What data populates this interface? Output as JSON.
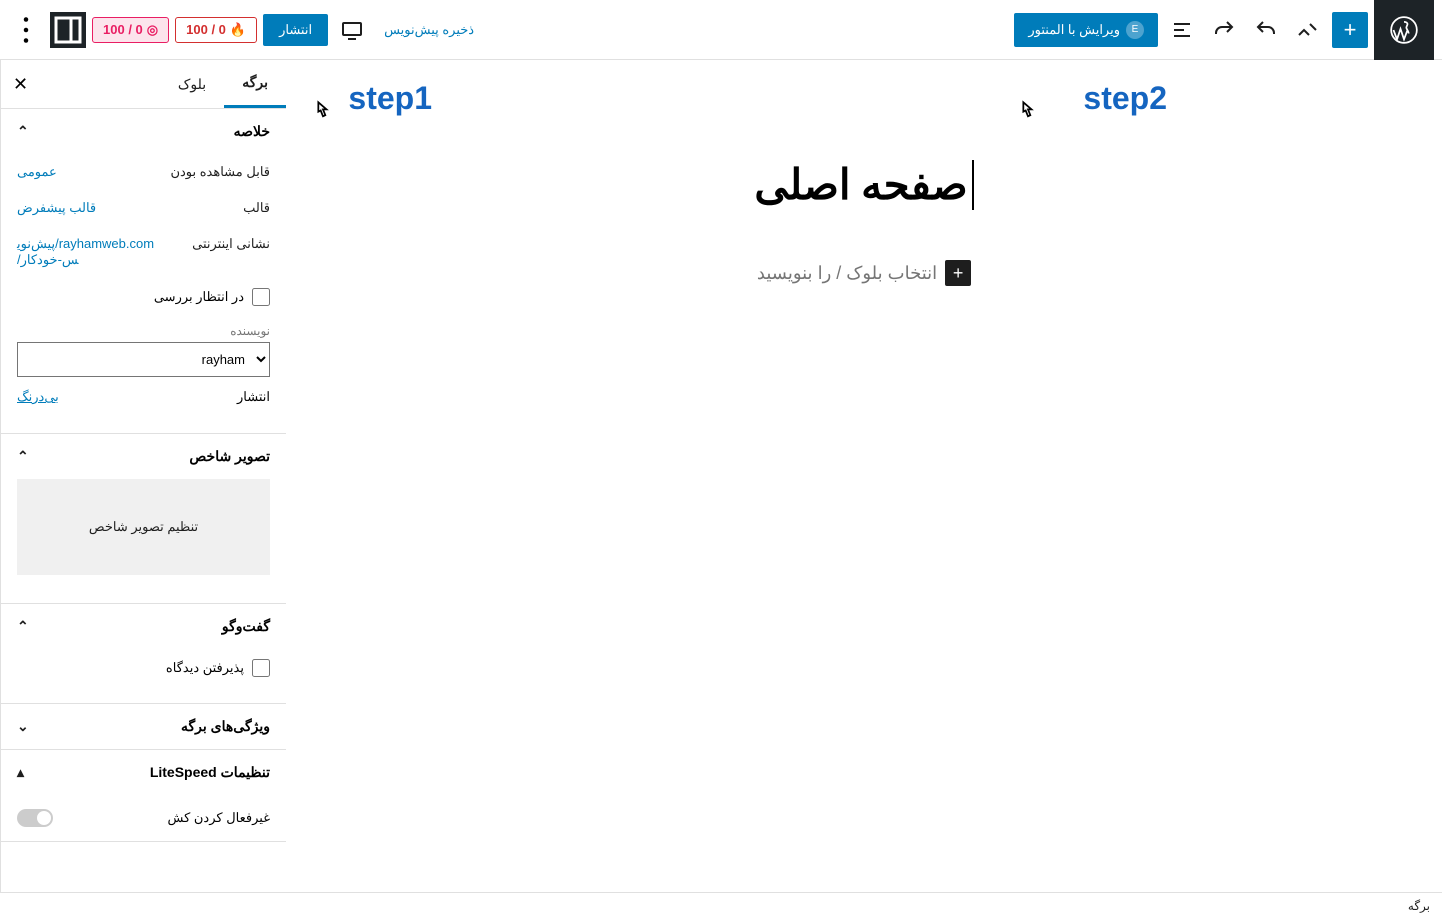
{
  "topbar": {
    "add_block_title": "+",
    "elementor_btn": "ویرایش با المنتور",
    "save_draft": "ذخیره پیش‌نویس",
    "publish": "انتشار",
    "score1": "0 / 100",
    "score2": "0 / 100"
  },
  "annotations": {
    "step1": "step1",
    "step2": "step2"
  },
  "canvas": {
    "page_title": "صفحه اصلی",
    "block_prompt": "انتخاب بلوک / را بنویسید"
  },
  "sidebar": {
    "tabs": {
      "page": "برگه",
      "block": "بلوک"
    },
    "summary": {
      "title": "خلاصه",
      "visibility_k": "قابل مشاهده بودن",
      "visibility_v": "عمومی",
      "template_k": "قالب",
      "template_v": "قالب پیشفرض",
      "url_k": "نشانی اینترنتی",
      "url_v": "rayhamweb.com/پیش‌نویس-خودکار/",
      "pending": "در انتظار بررسی",
      "author_label": "نویسنده",
      "author_value": "rayham",
      "publish_k": "انتشار",
      "publish_v": "بی‌درنگ"
    },
    "featured": {
      "title": "تصویر شاخص",
      "button": "تنظیم تصویر شاخص"
    },
    "discussion": {
      "title": "گفت‌وگو",
      "allow": "پذیرفتن دیدگاه"
    },
    "attributes": {
      "title": "ویژگی‌های برگه"
    },
    "litespeed": {
      "title": "تنظیمات LiteSpeed",
      "disable_cache": "غیرفعال کردن کش"
    }
  },
  "footer": {
    "breadcrumb": "برگه"
  }
}
